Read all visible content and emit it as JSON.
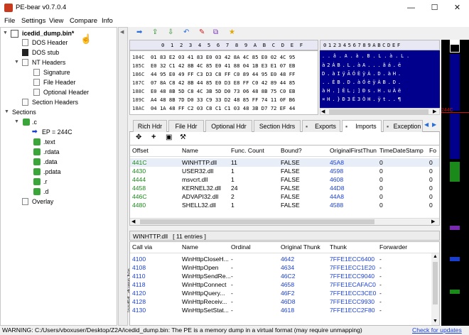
{
  "window": {
    "title": "PE-bear v0.7.0.4",
    "minimize": "—",
    "maximize": "☐",
    "close": "✕"
  },
  "menu": [
    "File",
    "Settings",
    "View",
    "Compare",
    "Info"
  ],
  "tree": {
    "root": "icedid_dump.bin*",
    "dos_header": "DOS Header",
    "dos_stub": "DOS stub",
    "nt_headers": "NT Headers",
    "signature": "Signature",
    "file_header": "File Header",
    "optional_header": "Optional Header",
    "section_headers": "Section Headers",
    "sections": "Sections",
    "c": ".c",
    "ep": "EP = 244C",
    "text": ".text",
    "rdata": ".rdata",
    "data": ".data",
    "pdata": ".pdata",
    "r": ".r",
    "d": ".d",
    "overlay": "Overlay"
  },
  "side_tab": "icedid_dump.bin",
  "hex": {
    "header": "   0  1  2  3  4  5  6  7  8  9  A  B  C  D  E  F",
    "ascii_header": "0123456789ABCDEF",
    "rows": [
      {
        "off": "184C",
        "hex": "01 83 E2 03 41 83 E0 03 42 8A 4C 85 E0 02 4C 95",
        "ascii": ". . â . A . à . B . L . à . L ."
      },
      {
        "off": "185C",
        "hex": "E0 32 C1 42 8B 4C 85 E0 41 88 04 1B E3 E1 07 EB",
        "ascii": "à2ÁB.L.àA...ãá.ë"
      },
      {
        "off": "186C",
        "hex": "44 95 E0 49 FF C3 D3 C8 FF C0 89 44 95 E0 48 FF",
        "ascii": "D.àIÿÃÓÈÿÀ.D.àH."
      },
      {
        "off": "187C",
        "hex": "07 8A C8 42 8B 44 85 E0 D3 E8 FF C0 42 89 44 85",
        "ascii": "..ÈB.D.àÓèÿÀB.D."
      },
      {
        "off": "188C",
        "hex": "E0 48 8B 5D C8 4C 3B 5D D0 73 06 48 8B 75 C0 EB",
        "ascii": "àH.]ÈL;]Ðs.H.uÀë"
      },
      {
        "off": "189C",
        "hex": "A4 48 8B 7D D0 33 C9 33 D2 48 85 FF 74 11 0F B6",
        "ascii": "¤H.}Ð3É3ÒH.ÿt..¶"
      },
      {
        "off": "18AC",
        "hex": "04 1A 48 FF C2 03 C8 C1 C1 03 48 3B D7 72 EF 44",
        "ascii": "..Hÿ.ÈÁÁ.H;×rïD"
      }
    ]
  },
  "tabs": [
    "Rich Hdr",
    "File Hdr",
    "Optional Hdr",
    "Section Hdrs",
    "Exports",
    "Imports",
    "Exception"
  ],
  "active_tab": "Imports",
  "imports": {
    "columns": [
      "Offset",
      "Name",
      "Func. Count",
      "Bound?",
      "OriginalFirstThun",
      "TimeDateStamp",
      "Fo"
    ],
    "rows": [
      {
        "offset": "441C",
        "name": "WINHTTP.dll",
        "count": "11",
        "bound": "FALSE",
        "oft": "45A8",
        "tds": "0",
        "fo": "0"
      },
      {
        "offset": "4430",
        "name": "USER32.dll",
        "count": "1",
        "bound": "FALSE",
        "oft": "4598",
        "tds": "0",
        "fo": "0"
      },
      {
        "offset": "4444",
        "name": "msvcrt.dll",
        "count": "1",
        "bound": "FALSE",
        "oft": "4608",
        "tds": "0",
        "fo": "0"
      },
      {
        "offset": "4458",
        "name": "KERNEL32.dll",
        "count": "24",
        "bound": "FALSE",
        "oft": "44D8",
        "tds": "0",
        "fo": "0"
      },
      {
        "offset": "446C",
        "name": "ADVAPI32.dll",
        "count": "2",
        "bound": "FALSE",
        "oft": "44A8",
        "tds": "0",
        "fo": "0"
      },
      {
        "offset": "4480",
        "name": "SHELL32.dll",
        "count": "1",
        "bound": "FALSE",
        "oft": "4588",
        "tds": "0",
        "fo": "0"
      }
    ]
  },
  "funcs": {
    "header": "WINHTTP.dll   [ 11 entries ]",
    "columns": [
      "Call via",
      "Name",
      "Ordinal",
      "Original Thunk",
      "Thunk",
      "Forwarder"
    ],
    "rows": [
      {
        "call": "4100",
        "name": "WinHttpCloseH...",
        "ord": "-",
        "orig": "4642",
        "thunk": "7FFE1ECC6400",
        "fwd": "-"
      },
      {
        "call": "4108",
        "name": "WinHttpOpen",
        "ord": "-",
        "orig": "4634",
        "thunk": "7FFE1ECC1E20",
        "fwd": "-"
      },
      {
        "call": "4110",
        "name": "WinHttpSendRe...",
        "ord": "-",
        "orig": "46C2",
        "thunk": "7FFE1ECC9040",
        "fwd": "-"
      },
      {
        "call": "4118",
        "name": "WinHttpConnect",
        "ord": "-",
        "orig": "4658",
        "thunk": "7FFE1ECAFAC0",
        "fwd": "-"
      },
      {
        "call": "4120",
        "name": "WinHttpQuery...",
        "ord": "-",
        "orig": "46F2",
        "thunk": "7FFE1ECC3CE0",
        "fwd": "-"
      },
      {
        "call": "4128",
        "name": "WinHttpReceiv...",
        "ord": "-",
        "orig": "46D8",
        "thunk": "7FFE1ECC9930",
        "fwd": "-"
      },
      {
        "call": "4130",
        "name": "WinHttpSetStat...",
        "ord": "-",
        "orig": "4618",
        "thunk": "7FFE1ECC2F80",
        "fwd": "-"
      }
    ]
  },
  "minimap_label": "244C",
  "status": {
    "text": "WARNING: C:/Users/vboxuser/Desktop/Z2A/icedid_dump.bin: The PE is a memory dump in a virtual format (may require unmapping)",
    "link": "Check for updates"
  },
  "colors": {
    "ascii_bg": "#00008c",
    "offset_green": "#1a8a1a",
    "link_blue": "#1a3fd0"
  }
}
